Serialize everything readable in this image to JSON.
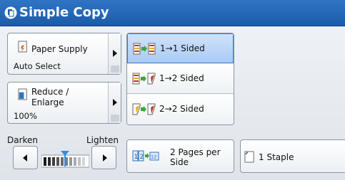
{
  "header": {
    "title": "Simple Copy",
    "icon": "copy-icon",
    "bar_color": "#1f62b0"
  },
  "paper_supply": {
    "label": "Paper Supply",
    "value": "Auto Select",
    "icon": "paper-supply-icon"
  },
  "reduce_enlarge": {
    "label_line1": "Reduce /",
    "label_line2": "Enlarge",
    "value": "100%",
    "icon": "reduce-enlarge-icon"
  },
  "sided_options": [
    {
      "label": "1→1 Sided",
      "selected": true,
      "icon": "one-to-one-sided-icon"
    },
    {
      "label": "1→2 Sided",
      "selected": false,
      "icon": "one-to-two-sided-icon"
    },
    {
      "label": "2→2 Sided",
      "selected": false,
      "icon": "two-to-two-sided-icon"
    }
  ],
  "density": {
    "darken_label": "Darken",
    "lighten_label": "Lighten",
    "level": 0.5,
    "icons": [
      "left-arrow-icon",
      "right-arrow-icon",
      "density-meter-icon"
    ]
  },
  "pages_per_side": {
    "label_line1": "2 Pages per",
    "label_line2": "Side",
    "icon": "n-up-icon"
  },
  "staple": {
    "label": "1 Staple",
    "icon": "staple-icon"
  },
  "colors": {
    "selected_fill": "#b5d2f7",
    "selected_border": "#3a7bd5"
  }
}
